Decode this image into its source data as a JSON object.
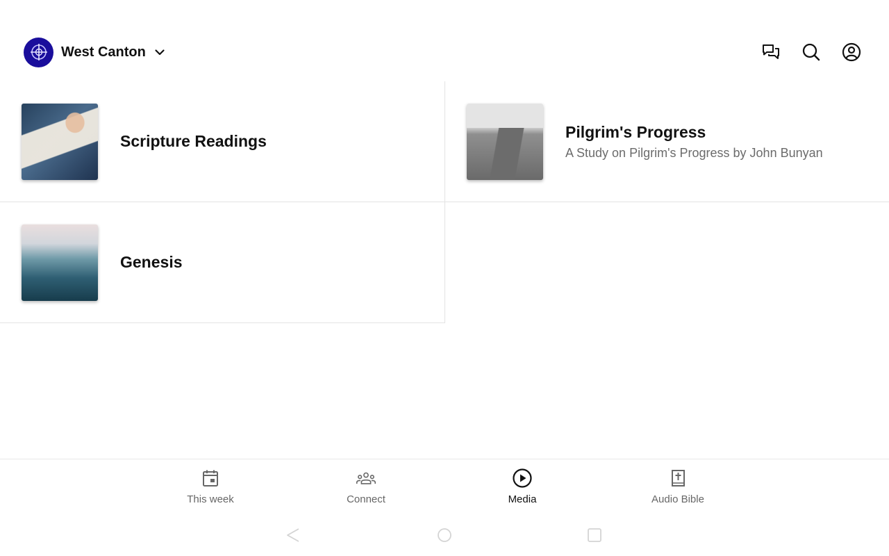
{
  "header": {
    "org_name": "West Canton",
    "logo_icon": "church-cross-logo-icon",
    "icons": [
      "chat-bubbles-icon",
      "search-icon",
      "account-circle-icon"
    ],
    "accent": "#1a0e9c"
  },
  "media": [
    {
      "title": "Scripture Readings",
      "subtitle": "",
      "image": "open-bible-photo"
    },
    {
      "title": "Pilgrim's Progress",
      "subtitle": "A Study on Pilgrim's Progress by John Bunyan",
      "image": "country-road-photo"
    },
    {
      "title": "Genesis",
      "subtitle": "",
      "image": "ocean-waves-photo"
    }
  ],
  "bottom_nav": {
    "items": [
      {
        "label": "This week",
        "icon": "calendar-icon",
        "active": false
      },
      {
        "label": "Connect",
        "icon": "group-icon",
        "active": false
      },
      {
        "label": "Media",
        "icon": "play-circle-icon",
        "active": true
      },
      {
        "label": "Audio Bible",
        "icon": "bible-icon",
        "active": false
      }
    ]
  },
  "system_nav": [
    "back-icon",
    "home-icon",
    "recents-icon"
  ]
}
